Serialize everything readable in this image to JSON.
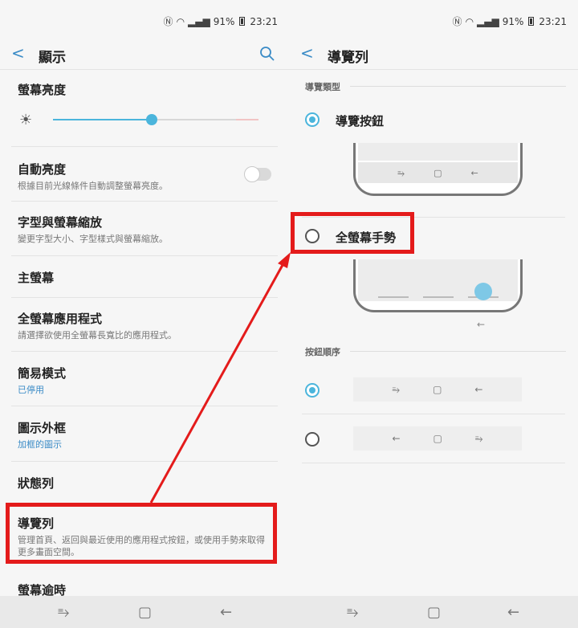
{
  "status": {
    "battery": "91%",
    "time": "23:21"
  },
  "left": {
    "title": "顯示",
    "brightness": {
      "label": "螢幕亮度",
      "level": 0.48
    },
    "items": [
      {
        "title": "自動亮度",
        "subtitle": "根據目前光線條件自動調整螢幕亮度。"
      },
      {
        "title": "字型與螢幕縮放",
        "subtitle": "變更字型大小、字型樣式與螢幕縮放。"
      },
      {
        "title": "主螢幕",
        "subtitle": ""
      },
      {
        "title": "全螢幕應用程式",
        "subtitle": "請選擇欲使用全螢幕長寬比的應用程式。"
      },
      {
        "title": "簡易模式",
        "subtitle": "已停用"
      },
      {
        "title": "圖示外框",
        "subtitle": "加框的圖示"
      },
      {
        "title": "狀態列",
        "subtitle": ""
      },
      {
        "title": "導覽列",
        "subtitle": "管理首頁、返回與最近使用的應用程式按鈕，或使用手勢來取得更多畫面空間。"
      },
      {
        "title": "螢幕逾時",
        "subtitle": ""
      }
    ]
  },
  "right": {
    "title": "導覽列",
    "nav_type_label": "導覽類型",
    "options": [
      {
        "label": "導覽按鈕",
        "selected": true
      },
      {
        "label": "全螢幕手勢",
        "selected": false
      }
    ],
    "order_label": "按鈕順序",
    "orders": [
      {
        "selected": true,
        "icons": [
          "⥱",
          "▢",
          "←"
        ]
      },
      {
        "selected": false,
        "icons": [
          "←",
          "▢",
          "⥱"
        ]
      }
    ],
    "preview_icons": [
      "⥱",
      "▢",
      "←"
    ],
    "gesture_hint_icon": "←"
  },
  "sysnav": {
    "left": [
      "⥱",
      "▢",
      "←"
    ],
    "right": [
      "⥱",
      "▢",
      "←"
    ]
  },
  "colors": {
    "accent": "#4bb5dc",
    "highlight": "#e41b1b"
  }
}
